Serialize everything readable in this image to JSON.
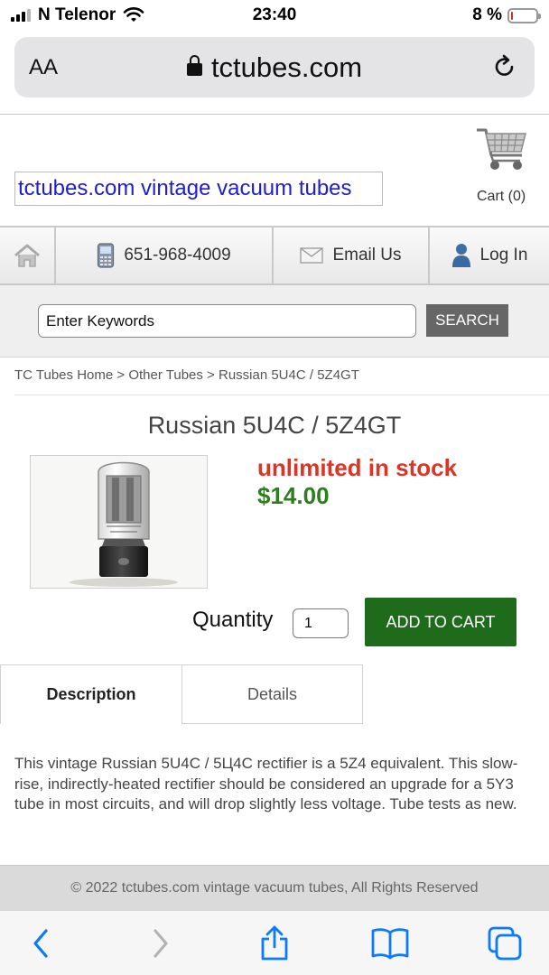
{
  "status_bar": {
    "carrier": "N Telenor",
    "time": "23:40",
    "battery": "8 %",
    "battery_level": 0.08
  },
  "browser": {
    "text_size_label": "AA",
    "url": "tctubes.com"
  },
  "header": {
    "site_title": "tctubes.com vintage vacuum tubes",
    "cart_label": "Cart (0)"
  },
  "nav": {
    "phone": "651-968-4009",
    "email": "Email Us",
    "login": "Log In"
  },
  "search": {
    "placeholder": "Enter Keywords",
    "button": "SEARCH"
  },
  "breadcrumb": [
    "TC Tubes Home",
    "Other Tubes",
    "Russian 5U4C / 5Z4GT"
  ],
  "product": {
    "title": "Russian 5U4C / 5Z4GT",
    "stock": "unlimited in stock",
    "price": "$14.00",
    "quantity_label": "Quantity",
    "quantity_value": "1",
    "add_to_cart": "ADD TO CART"
  },
  "tabs": {
    "description": "Description",
    "details": "Details"
  },
  "description": "This vintage Russian 5U4C / 5Ц4С rectifier is a 5Z4 equivalent. This slow-rise, indirectly-heated rectifier should be considered an upgrade for a 5Y3 tube in most circuits, and will drop slightly less voltage. Tube tests as new.",
  "footer": "© 2022 tctubes.com vintage vacuum tubes, All Rights Reserved",
  "colors": {
    "stock": "#dd3525",
    "price": "#2e7d1e",
    "add_to_cart_bg": "#1e6b1c",
    "link": "#1d1dd4",
    "ios_blue": "#0a7aff"
  }
}
